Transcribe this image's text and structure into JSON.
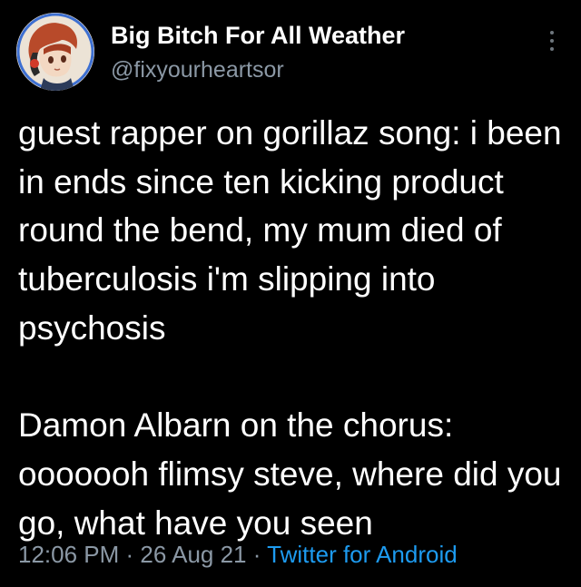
{
  "author": {
    "display_name": "Big Bitch For All Weather",
    "handle": "@fixyourheartsor",
    "avatar_icon": "anime-avatar"
  },
  "tweet": {
    "text": "guest rapper on gorillaz song: i been in ends since ten kicking product round the bend, my mum died of tuberculosis i'm slipping into psychosis\n\nDamon Albarn on the chorus: ooooooh flimsy steve, where did you go, what have you seen"
  },
  "meta": {
    "time": "12:06 PM",
    "separator": " · ",
    "date": "26 Aug 21",
    "source": "Twitter for Android"
  },
  "colors": {
    "background": "#000000",
    "text": "#ffffff",
    "muted": "#8b98a5",
    "link": "#1d9bf0"
  },
  "icons": {
    "more": "more-vertical-icon"
  }
}
